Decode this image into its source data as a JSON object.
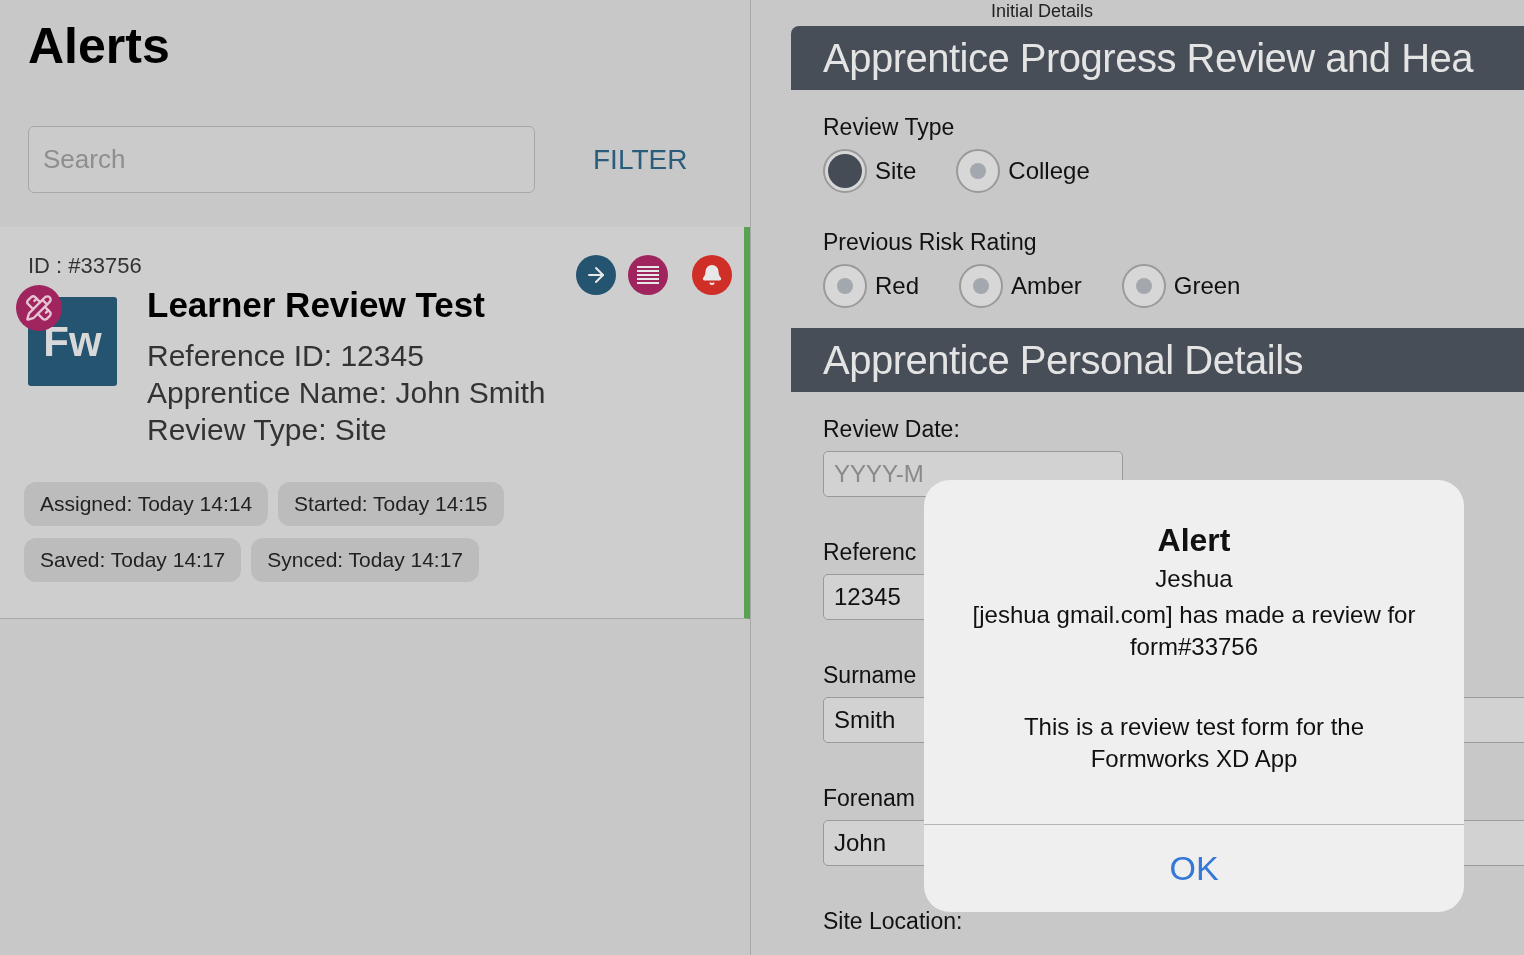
{
  "alerts_panel": {
    "title": "Alerts",
    "search": {
      "placeholder": "Search"
    },
    "filter_button": "FILTER",
    "cards": [
      {
        "id": "ID : #33756",
        "logo": "Fw",
        "title": "Learner Review Test",
        "selected": true,
        "details": [
          "Reference ID: 12345",
          "Apprentice Name: John Smith",
          "Review Type: Site"
        ],
        "tags": [
          "Assigned: Today 14:14",
          "Started: Today 14:15",
          "Saved: Today 14:17",
          "Synced: Today 14:17"
        ]
      }
    ]
  },
  "form": {
    "page_title": "Initial Details",
    "sections": [
      {
        "heading": "Apprentice Progress Review and Hea",
        "fields": [
          {
            "kind": "radio",
            "label": "Review Type",
            "options": [
              {
                "label": "Site",
                "selected": true
              },
              {
                "label": "College",
                "selected": false
              }
            ]
          },
          {
            "kind": "radio",
            "label": "Previous Risk Rating",
            "options": [
              {
                "label": "Red",
                "selected": false
              },
              {
                "label": "Amber",
                "selected": false
              },
              {
                "label": "Green",
                "selected": false
              }
            ]
          }
        ]
      },
      {
        "heading": "Apprentice Personal Details",
        "fields": [
          {
            "kind": "short",
            "label": "Review Date:",
            "placeholder": "YYYY-M"
          },
          {
            "kind": "short",
            "label": "Referenc",
            "value": "12345"
          },
          {
            "kind": "wide",
            "label": "Surname",
            "value": "Smith"
          },
          {
            "kind": "wide",
            "label": "Forenam",
            "value": "John"
          },
          {
            "kind": "label",
            "label": "Site Location:"
          }
        ]
      }
    ]
  },
  "dialog": {
    "title": "Alert",
    "message_lines": [
      "Jeshua",
      "[jeshua gmail.com] has made a review for form#33756"
    ],
    "body": "This is a review test form for the Formworks XD App",
    "button": "OK"
  }
}
